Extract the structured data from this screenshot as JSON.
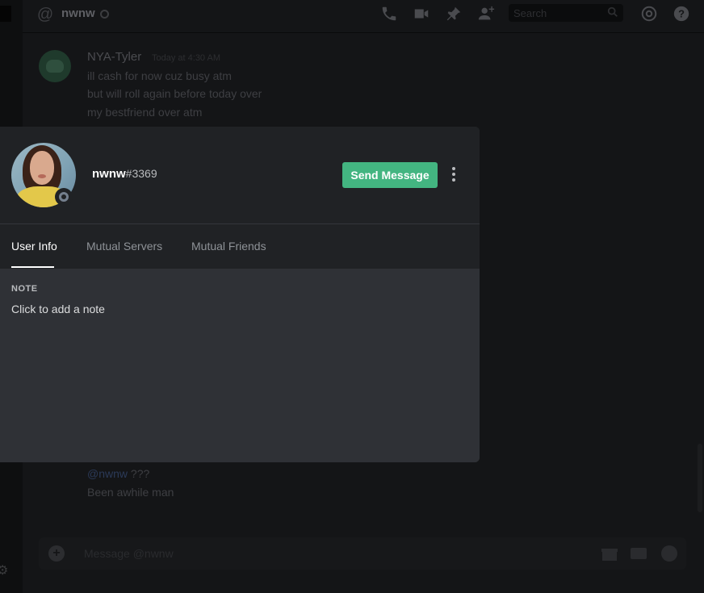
{
  "topbar": {
    "dm_name": "nwnw",
    "search_placeholder": "Search"
  },
  "background_chat": {
    "author": "NYA-Tyler",
    "timestamp": "Today at 4:30 AM",
    "lines": [
      "ill cash for now cuz busy atm",
      "but will roll again before today over",
      "my bestfriend over atm"
    ],
    "mention": "@nwnw",
    "mention_suffix": " ???",
    "last_line": "Been awhile man",
    "composer_placeholder": "Message @nwnw"
  },
  "profile": {
    "username": "nwnw",
    "discriminator": "#3369",
    "status": "offline",
    "send_message_label": "Send Message",
    "tabs": [
      "User Info",
      "Mutual Servers",
      "Mutual Friends"
    ],
    "active_tab": "User Info",
    "note_title": "NOTE",
    "note_placeholder": "Click to add a note"
  },
  "colors": {
    "accent_green": "#43b581",
    "header_bg": "#202225",
    "body_bg": "#2f3136"
  }
}
